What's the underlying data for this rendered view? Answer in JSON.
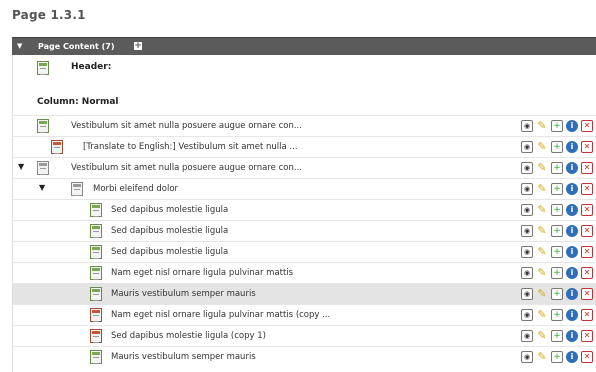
{
  "page_title": "Page 1.3.1",
  "panel": {
    "title": "Page Content (7)",
    "add_symbol": "+"
  },
  "header_label": "Header:",
  "column_label": "Column: Normal",
  "rows": [
    {
      "text": "Vestibulum sit amet nulla posuere augue ornare con...",
      "icon": "content-element-icon"
    },
    {
      "text": "[Translate to English:] Vestibulum sit amet nulla ...",
      "icon": "translated-element-icon"
    },
    {
      "text": "Vestibulum sit amet nulla posuere augue ornare con...",
      "icon": "container-element-icon",
      "toggle": "▼"
    },
    {
      "text": "Morbi eleifend dolor",
      "icon": "container-element-icon",
      "toggle": "▼"
    },
    {
      "text": "Sed dapibus molestie ligula",
      "icon": "content-element-icon"
    },
    {
      "text": "Sed dapibus molestie ligula",
      "icon": "content-element-icon"
    },
    {
      "text": "Sed dapibus molestie ligula",
      "icon": "content-element-icon"
    },
    {
      "text": "Nam eget nisl ornare ligula pulvinar mattis",
      "icon": "content-element-icon"
    },
    {
      "text": "Mauris vestibulum semper mauris",
      "icon": "content-element-icon"
    },
    {
      "text": "Nam eget nisl ornare ligula pulvinar mattis (copy ...",
      "icon": "hidden-element-icon"
    },
    {
      "text": "Sed dapibus molestie ligula (copy 1)",
      "icon": "hidden-element-icon"
    },
    {
      "text": "Mauris vestibulum semper mauris",
      "icon": "content-element-icon"
    }
  ],
  "row_action_icons": [
    "view-icon",
    "edit-icon",
    "new-element-icon",
    "info-icon",
    "delete-icon"
  ],
  "colors": {
    "panel_header": "#5b5b5b",
    "highlight_row": "#e4e4e4",
    "info": "#2f6fb7",
    "edit": "#d4a91a",
    "delete": "#b33333"
  }
}
